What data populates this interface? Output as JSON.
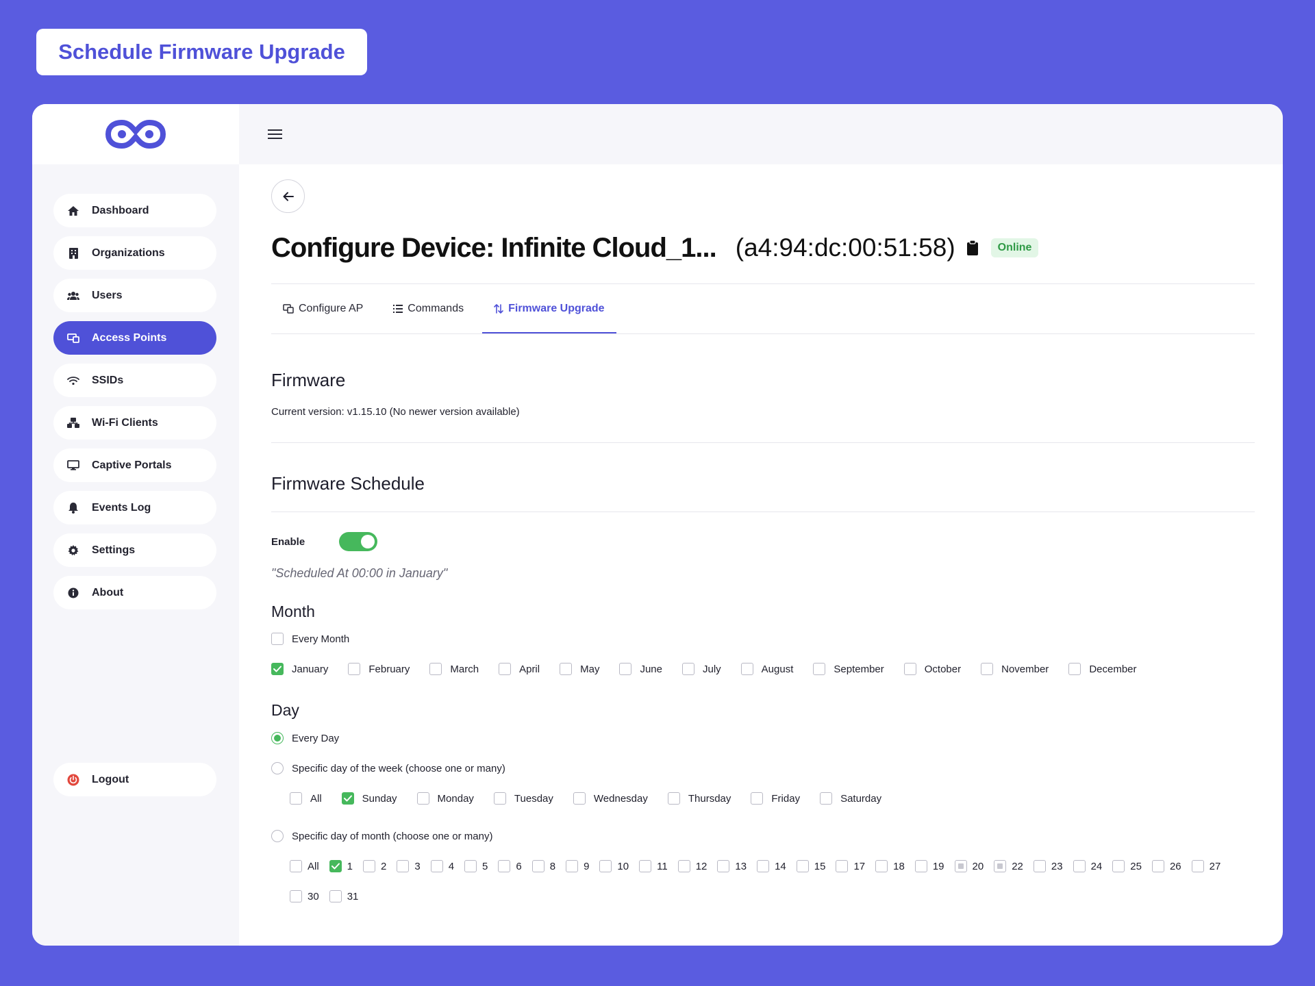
{
  "banner": {
    "title": "Schedule Firmware Upgrade"
  },
  "colors": {
    "accent": "#4f51d8",
    "success": "#46b85c",
    "background": "#5a5ce0"
  },
  "sidebar": {
    "items": [
      {
        "label": "Dashboard",
        "icon": "dashboard-icon"
      },
      {
        "label": "Organizations",
        "icon": "building-icon"
      },
      {
        "label": "Users",
        "icon": "users-icon"
      },
      {
        "label": "Access Points",
        "icon": "access-point-icon"
      },
      {
        "label": "SSIDs",
        "icon": "wifi-icon"
      },
      {
        "label": "Wi-Fi Clients",
        "icon": "clients-icon"
      },
      {
        "label": "Captive Portals",
        "icon": "monitor-icon"
      },
      {
        "label": "Events Log",
        "icon": "bell-icon"
      },
      {
        "label": "Settings",
        "icon": "gear-icon"
      },
      {
        "label": "About",
        "icon": "info-icon"
      }
    ],
    "active": "Access Points",
    "logout": "Logout"
  },
  "header": {
    "title": "Configure Device: Infinite Cloud_1...",
    "mac": "(a4:94:dc:00:51:58)",
    "status": "Online"
  },
  "tabs": [
    {
      "label": "Configure AP",
      "icon": "configure-icon"
    },
    {
      "label": "Commands",
      "icon": "list-icon"
    },
    {
      "label": "Firmware Upgrade",
      "icon": "upgrade-arrows-icon"
    }
  ],
  "firmware": {
    "title": "Firmware",
    "current": "Current version: v1.15.10 (No newer version available)"
  },
  "schedule": {
    "title": "Firmware Schedule",
    "enable_label": "Enable",
    "enabled": true,
    "summary": "\"Scheduled At 00:00 in January\"",
    "month": {
      "title": "Month",
      "every_label": "Every Month",
      "every_checked": false,
      "options": [
        {
          "label": "January",
          "checked": true
        },
        {
          "label": "February",
          "checked": false
        },
        {
          "label": "March",
          "checked": false
        },
        {
          "label": "April",
          "checked": false
        },
        {
          "label": "May",
          "checked": false
        },
        {
          "label": "June",
          "checked": false
        },
        {
          "label": "July",
          "checked": false
        },
        {
          "label": "August",
          "checked": false
        },
        {
          "label": "September",
          "checked": false
        },
        {
          "label": "October",
          "checked": false
        },
        {
          "label": "November",
          "checked": false
        },
        {
          "label": "December",
          "checked": false
        }
      ]
    },
    "day": {
      "title": "Day",
      "every_day_label": "Every Day",
      "week_label": "Specific day of the week (choose one or many)",
      "month_label": "Specific day of month (choose one or many)",
      "selected_mode": "every_day",
      "week_options": [
        {
          "label": "All",
          "checked": false
        },
        {
          "label": "Sunday",
          "checked": true
        },
        {
          "label": "Monday",
          "checked": false
        },
        {
          "label": "Tuesday",
          "checked": false
        },
        {
          "label": "Wednesday",
          "checked": false
        },
        {
          "label": "Thursday",
          "checked": false
        },
        {
          "label": "Friday",
          "checked": false
        },
        {
          "label": "Saturday",
          "checked": false
        }
      ],
      "month_day_options": [
        {
          "label": "All",
          "state": "unchecked"
        },
        {
          "label": "1",
          "state": "checked"
        },
        {
          "label": "2",
          "state": "unchecked"
        },
        {
          "label": "3",
          "state": "unchecked"
        },
        {
          "label": "4",
          "state": "unchecked"
        },
        {
          "label": "5",
          "state": "unchecked"
        },
        {
          "label": "6",
          "state": "unchecked"
        },
        {
          "label": "8",
          "state": "unchecked"
        },
        {
          "label": "9",
          "state": "unchecked"
        },
        {
          "label": "10",
          "state": "unchecked"
        },
        {
          "label": "11",
          "state": "unchecked"
        },
        {
          "label": "12",
          "state": "unchecked"
        },
        {
          "label": "13",
          "state": "unchecked"
        },
        {
          "label": "14",
          "state": "unchecked"
        },
        {
          "label": "15",
          "state": "unchecked"
        },
        {
          "label": "17",
          "state": "unchecked"
        },
        {
          "label": "18",
          "state": "unchecked"
        },
        {
          "label": "19",
          "state": "unchecked"
        },
        {
          "label": "20",
          "state": "partial"
        },
        {
          "label": "22",
          "state": "partial"
        },
        {
          "label": "23",
          "state": "unchecked"
        },
        {
          "label": "24",
          "state": "unchecked"
        },
        {
          "label": "25",
          "state": "unchecked"
        },
        {
          "label": "26",
          "state": "unchecked"
        },
        {
          "label": "27",
          "state": "unchecked"
        }
      ],
      "month_day_options_row2": [
        {
          "label": "30",
          "state": "unchecked"
        },
        {
          "label": "31",
          "state": "unchecked"
        }
      ]
    }
  }
}
